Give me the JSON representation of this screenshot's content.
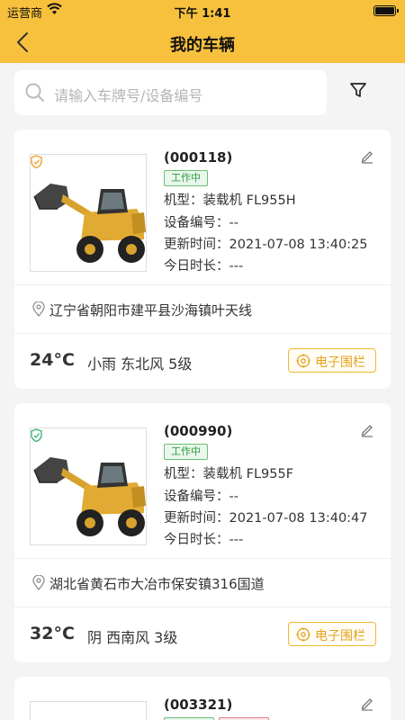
{
  "status_bar": {
    "carrier": "运营商",
    "time": "下午 1:41"
  },
  "nav": {
    "title": "我的车辆"
  },
  "search": {
    "placeholder": "请输入车牌号/设备编号"
  },
  "labels": {
    "model": "机型：",
    "device": "设备编号：",
    "update": "更新时间：",
    "today": "今日时长："
  },
  "vehicles": [
    {
      "code": "(000118)",
      "status": "工作中",
      "model": "装载机 FL955H",
      "device": "--",
      "update": "2021-07-08 13:40:25",
      "today": "---",
      "location": "辽宁省朝阳市建平县沙海镇叶天线",
      "temp": "24°C",
      "weather": "小雨 东北风 5级",
      "fence": "电子围栏",
      "shield_color": "#f0a030"
    },
    {
      "code": "(000990)",
      "status": "工作中",
      "model": "装载机 FL955F",
      "device": "--",
      "update": "2021-07-08 13:40:47",
      "today": "---",
      "location": "湖北省黄石市大冶市保安镇316国道",
      "temp": "32°C",
      "weather": "阴 西南风 3级",
      "fence": "电子围栏",
      "shield_color": "#3cb371"
    },
    {
      "code": "(003321)"
    }
  ],
  "colors": {
    "header": "#f7c13d",
    "accent": "#e6a21c",
    "status_green": "#2f9e44"
  }
}
